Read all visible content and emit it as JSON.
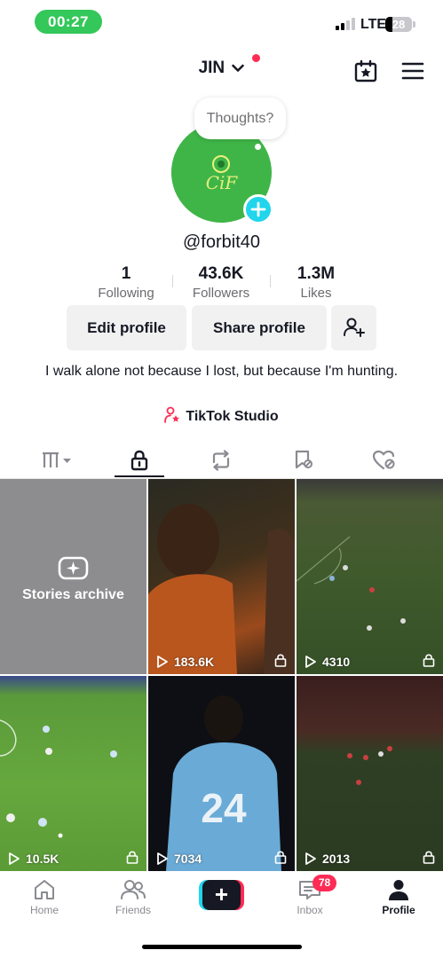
{
  "status_bar": {
    "time": "00:27",
    "network": "LTE",
    "battery": "28",
    "battery_level": 0.28
  },
  "header": {
    "name": "JIN",
    "icons": [
      "calendar-star-icon",
      "hamburger-menu-icon"
    ]
  },
  "profile": {
    "thought_bubble": "Thoughts?",
    "avatar_text": "CiF",
    "username": "@forbit40",
    "stats": [
      {
        "value": "1",
        "label": "Following"
      },
      {
        "value": "43.6K",
        "label": "Followers"
      },
      {
        "value": "1.3M",
        "label": "Likes"
      }
    ],
    "buttons": {
      "edit": "Edit profile",
      "share": "Share profile"
    },
    "bio": "I walk alone not because I lost, but because I'm hunting.",
    "studio_link": "TikTok Studio"
  },
  "tabs": [
    {
      "icon": "grid-columns-icon",
      "active": false
    },
    {
      "icon": "lock-icon",
      "active": true
    },
    {
      "icon": "repost-icon",
      "active": false
    },
    {
      "icon": "bookmark-icon",
      "active": false
    },
    {
      "icon": "heart-hidden-icon",
      "active": false
    }
  ],
  "grid": {
    "archive_label": "Stories archive",
    "videos": [
      {
        "views": "183.6K",
        "locked": true
      },
      {
        "views": "4310",
        "locked": true
      },
      {
        "views": "10.5K",
        "locked": true
      },
      {
        "views": "7034",
        "locked": true
      },
      {
        "views": "2013",
        "locked": true
      }
    ]
  },
  "bottom_nav": {
    "items": [
      {
        "label": "Home",
        "icon": "home-icon"
      },
      {
        "label": "Friends",
        "icon": "friends-icon"
      },
      {
        "label": "",
        "icon": "plus-icon"
      },
      {
        "label": "Inbox",
        "icon": "inbox-icon",
        "badge": "78"
      },
      {
        "label": "Profile",
        "icon": "profile-icon",
        "active": true
      }
    ]
  },
  "colors": {
    "brand_red": "#fe2c55",
    "brand_cyan": "#20d5ec",
    "status_green": "#34c759",
    "avatar_green": "#3fb548"
  }
}
